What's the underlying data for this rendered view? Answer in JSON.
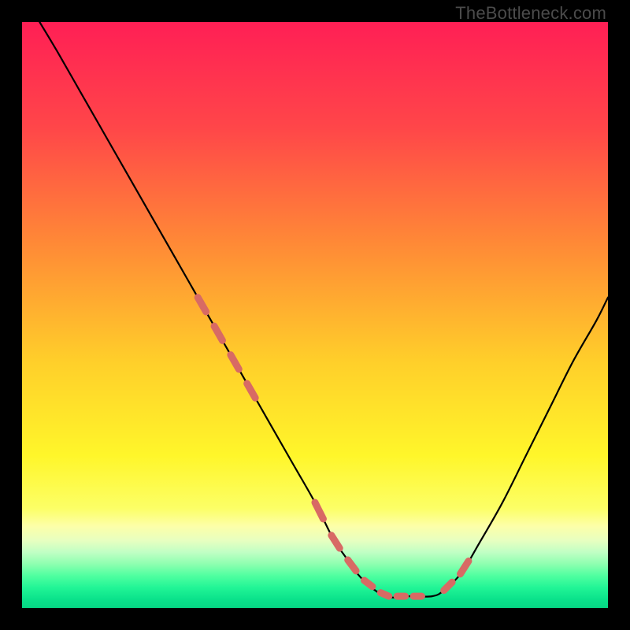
{
  "watermark": "TheBottleneck.com",
  "chart_data": {
    "type": "line",
    "title": "",
    "xlabel": "",
    "ylabel": "",
    "xlim": [
      0,
      100
    ],
    "ylim": [
      0,
      100
    ],
    "grid": false,
    "legend": false,
    "series": [
      {
        "name": "curve",
        "color": "#000000",
        "x": [
          3,
          6,
          10,
          14,
          18,
          22,
          26,
          30,
          34,
          38,
          42,
          46,
          50,
          53,
          55,
          58,
          62,
          66,
          70,
          72,
          75,
          78,
          82,
          86,
          90,
          94,
          98,
          100
        ],
        "y": [
          100,
          95,
          88,
          81,
          74,
          67,
          60,
          53,
          46,
          39,
          32,
          25,
          18,
          12,
          9,
          5,
          2,
          2,
          2,
          3,
          6,
          11,
          18,
          26,
          34,
          42,
          49,
          53
        ]
      }
    ],
    "highlight_segments": {
      "name": "segment-dots",
      "color": "#d86a64",
      "ranges_x": [
        [
          30,
          40
        ],
        [
          50,
          70
        ],
        [
          72,
          79
        ]
      ]
    },
    "background": {
      "type": "vertical-gradient",
      "stops": [
        {
          "pos": 0.0,
          "color": "#ff1f55"
        },
        {
          "pos": 0.18,
          "color": "#ff4649"
        },
        {
          "pos": 0.38,
          "color": "#ff8a36"
        },
        {
          "pos": 0.58,
          "color": "#ffcf2a"
        },
        {
          "pos": 0.74,
          "color": "#fff62a"
        },
        {
          "pos": 0.83,
          "color": "#fcff66"
        },
        {
          "pos": 0.86,
          "color": "#fdffa8"
        },
        {
          "pos": 0.885,
          "color": "#e7ffc0"
        },
        {
          "pos": 0.905,
          "color": "#c0ffc4"
        },
        {
          "pos": 0.925,
          "color": "#8effb0"
        },
        {
          "pos": 0.945,
          "color": "#4fffa0"
        },
        {
          "pos": 0.965,
          "color": "#22f596"
        },
        {
          "pos": 0.985,
          "color": "#0ae28b"
        },
        {
          "pos": 1.0,
          "color": "#06d684"
        }
      ]
    }
  }
}
